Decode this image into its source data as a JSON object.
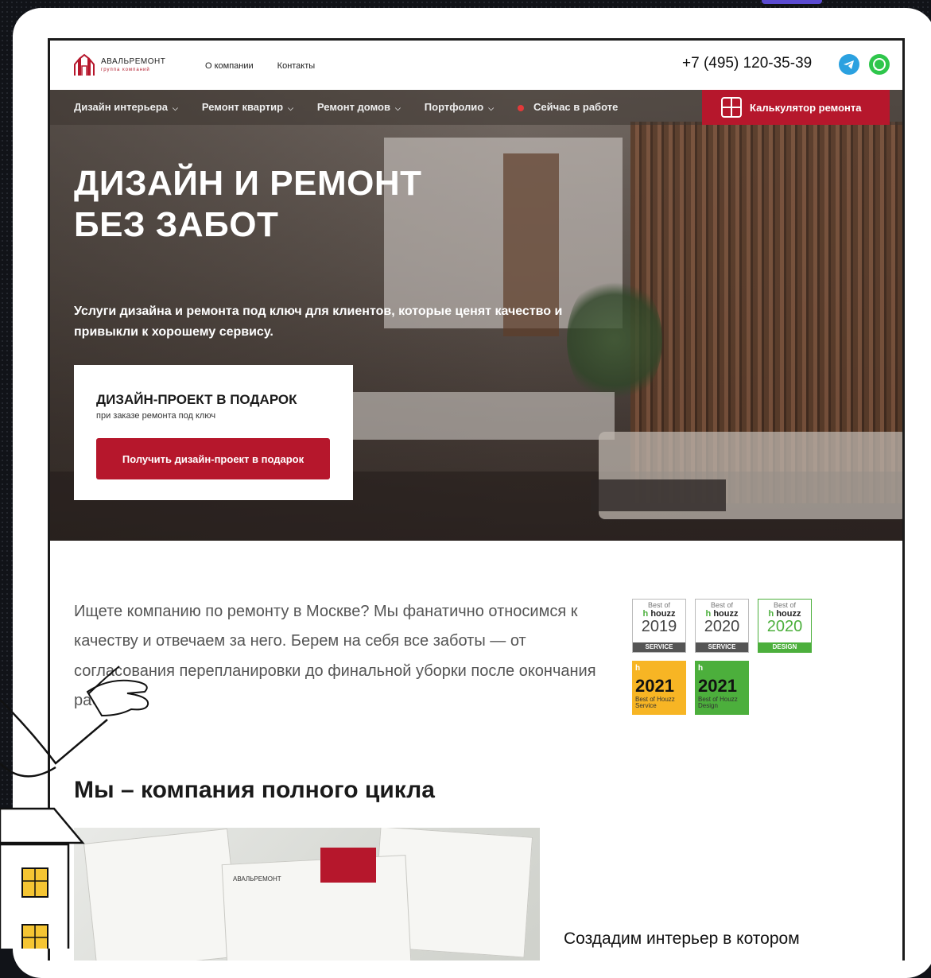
{
  "brand": {
    "name": "АВАЛЬРЕМОНТ",
    "tagline": "группа компаний"
  },
  "top_nav": [
    "О компании",
    "Контакты"
  ],
  "phone": "+7 (495) 120-35-39",
  "menu": {
    "items": [
      {
        "label": "Дизайн интерьера",
        "has_dropdown": true
      },
      {
        "label": "Ремонт квартир",
        "has_dropdown": true
      },
      {
        "label": "Ремонт домов",
        "has_dropdown": true
      },
      {
        "label": "Портфолио",
        "has_dropdown": true
      }
    ],
    "live_label": "Сейчас в работе",
    "calc_label": "Калькулятор ремонта"
  },
  "hero": {
    "title_line1": "ДИЗАЙН И РЕМОНТ",
    "title_line2": "БЕЗ ЗАБОТ",
    "subtitle": "Услуги дизайна и ремонта под ключ для клиентов, которые ценят качество и привыкли к хорошему сервису."
  },
  "promo": {
    "title": "ДИЗАЙН-ПРОЕКТ В ПОДАРОК",
    "note": "при заказе ремонта под ключ",
    "button": "Получить дизайн-проект в подарок"
  },
  "intro_text": "Ищете компанию по ремонту в Москве? Мы фанатично относимся к качеству и отвечаем за него. Берем на себя все заботы — от согласования перепланировки до финальной уборки после окончания работ.",
  "badges": [
    {
      "best": "Best of",
      "brand": "houzz",
      "year": "2019",
      "kind": "SERVICE"
    },
    {
      "best": "Best of",
      "brand": "houzz",
      "year": "2020",
      "kind": "SERVICE"
    },
    {
      "best": "Best of",
      "brand": "houzz",
      "year": "2020",
      "kind": "DESIGN"
    },
    {
      "year": "2021",
      "caption": "Best of Houzz Service"
    },
    {
      "year": "2021",
      "caption": "Best of Houzz Design"
    }
  ],
  "section_title": "Мы – компания полного цикла",
  "plans_caption": "Создадим интерьер в котором",
  "plans_logo": "АВАЛЬРЕМОНТ",
  "colors": {
    "accent": "#b6172c",
    "telegram": "#2ba1e0",
    "whatsapp": "#2ec64b",
    "houzz_green": "#4caf3c",
    "badge_gold": "#f7b524"
  }
}
